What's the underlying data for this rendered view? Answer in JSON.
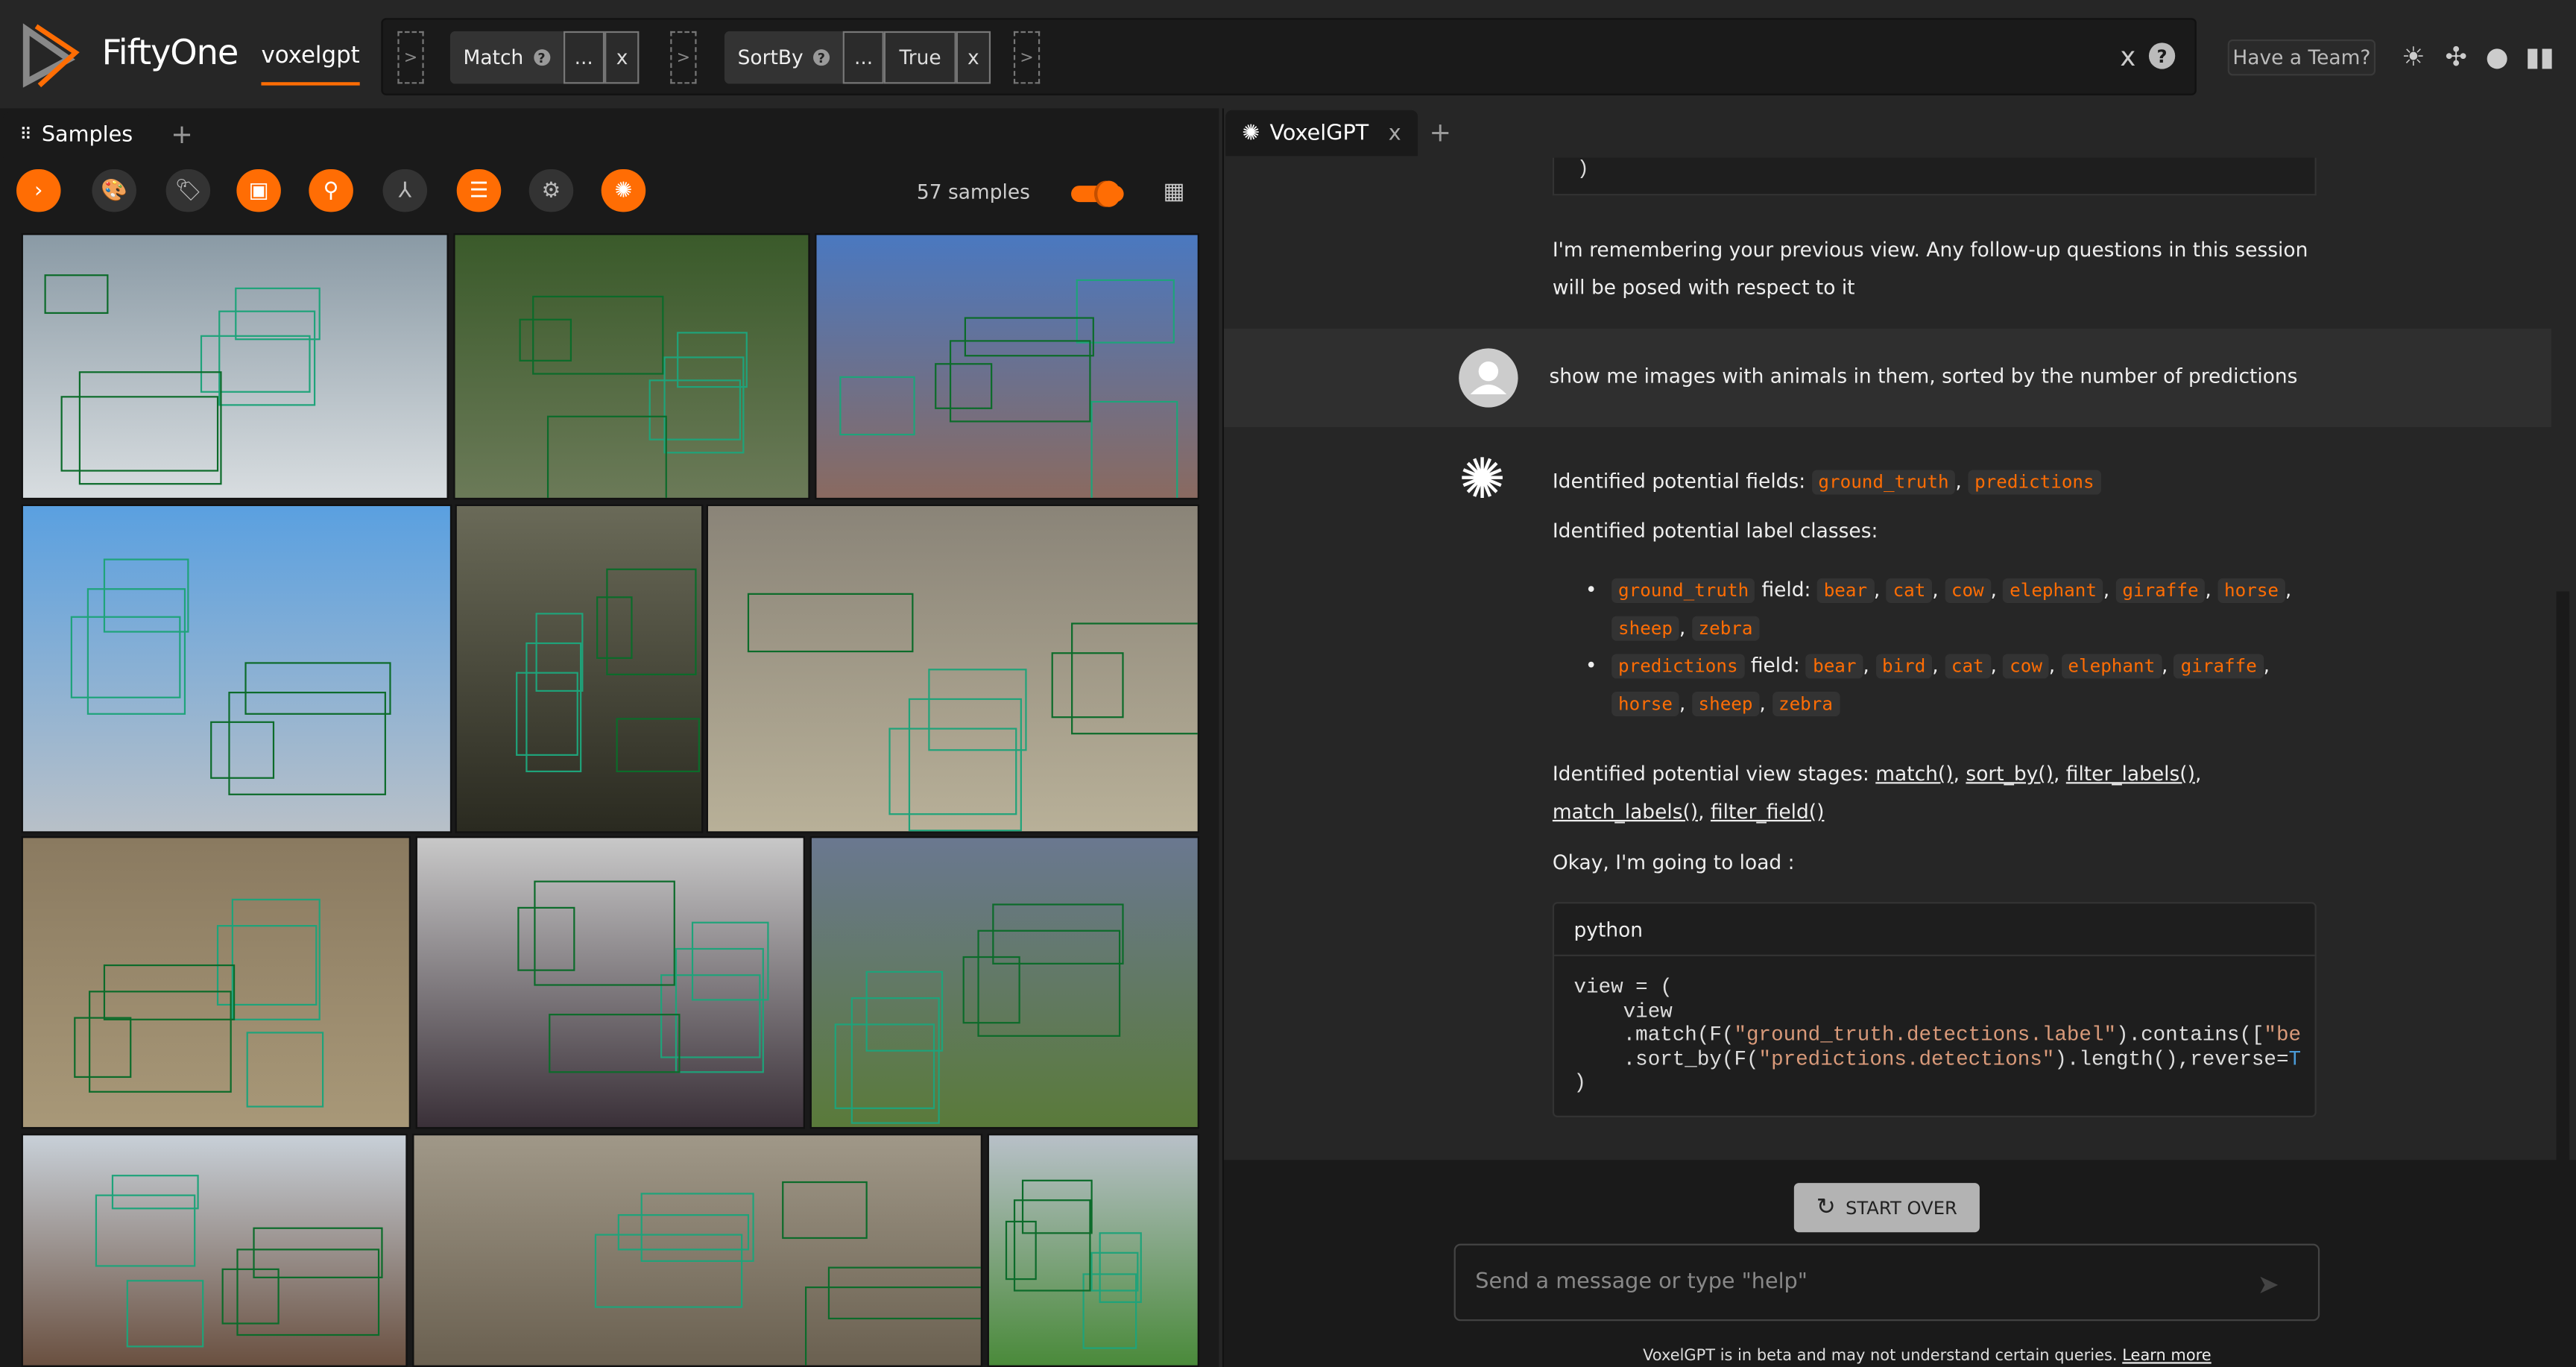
{
  "header": {
    "brand": "FiftyOne",
    "dataset": "voxelgpt",
    "team_button": "Have a Team?"
  },
  "view_bar": {
    "stages": [
      {
        "name": "Match",
        "help": "?",
        "more": "...",
        "close": "x"
      },
      {
        "name": "SortBy",
        "help": "?",
        "more": "...",
        "value": "True",
        "close": "x"
      }
    ],
    "add": ">",
    "clear": "x",
    "help": "?"
  },
  "samples_panel": {
    "tab": "Samples",
    "add_tab": "+",
    "count": "57 samples",
    "toggle_on": true
  },
  "voxelgpt": {
    "tab": "VoxelGPT",
    "tab_close": "x",
    "add_tab": "+",
    "prev_code_tail": ")",
    "memory_msg": "I'm remembering your previous view. Any follow-up questions in this session will be posed with respect to it",
    "user_msg": "show me images with animals in them, sorted by the number of predictions",
    "fields_label": "Identified potential fields:",
    "fields": [
      "ground_truth",
      "predictions"
    ],
    "classes_label": "Identified potential label classes:",
    "class_groups": [
      {
        "field": "ground_truth",
        "suffix": "field:",
        "classes": [
          "bear",
          "cat",
          "cow",
          "elephant",
          "giraffe",
          "horse",
          "sheep",
          "zebra"
        ]
      },
      {
        "field": "predictions",
        "suffix": "field:",
        "classes": [
          "bear",
          "bird",
          "cat",
          "cow",
          "elephant",
          "giraffe",
          "horse",
          "sheep",
          "zebra"
        ]
      }
    ],
    "stages_label": "Identified potential view stages:",
    "stages": [
      "match()",
      "sort_by()",
      "filter_labels()",
      "match_labels()",
      "filter_field()"
    ],
    "load_msg": "Okay, I'm going to load :",
    "code_lang": "python",
    "code": {
      "l1": "view = (",
      "l2": "    view",
      "l3a": "    .match(F(",
      "l3s": "\"ground_truth.detections.label\"",
      "l3b": ").contains([",
      "l3c": "\"be",
      "l4a": "    .sort_by(F(",
      "l4s": "\"predictions.detections\"",
      "l4b": ").length(),reverse=",
      "l4c": "T",
      "l5": ")"
    },
    "start_over": "START OVER",
    "input_placeholder": "Send a message or type \"help\"",
    "footer": "VoxelGPT is in beta and may not understand certain queries.",
    "footer_link": "Learn more"
  },
  "colors": {
    "accent": "#ff6d04",
    "background": "#262626",
    "panel": "#1a1a1a"
  }
}
